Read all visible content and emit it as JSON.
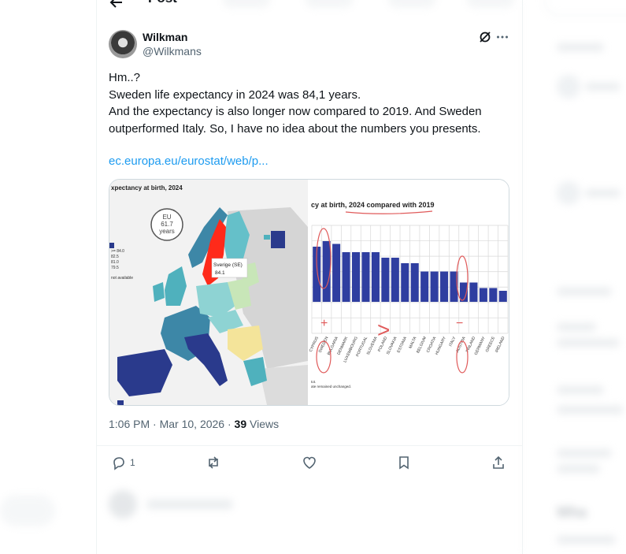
{
  "header": {
    "title": "Post"
  },
  "author": {
    "display_name": "Wilkman",
    "handle": "@Wilkmans"
  },
  "tweet": {
    "lines": [
      "Hm..?",
      "Sweden life expectancy in 2024 was 84,1 years.",
      "And the expectancy is also longer now compared to 2019. And Sweden",
      "outperformed Italy. So, I have no idea about the numbers you presents."
    ],
    "link": "ec.europa.eu/eurostat/web/p..."
  },
  "map_image": {
    "title": "xpectancy at birth, 2024",
    "eu_badge": [
      "EU",
      "61.7",
      "years"
    ],
    "legend": [
      ">= 84.0",
      "82.5",
      "81.0",
      "79.5",
      "not available"
    ],
    "callout_country": "Sverige (SE)",
    "callout_value": "84.1"
  },
  "bar_image": {
    "title": "cy at birth, 2024 compared with 2019",
    "countries": [
      "CYPRUS",
      "SWEDEN",
      "BULGARIA",
      "DENMARK",
      "LUXEMBOURG",
      "PORTUGAL",
      "SLOVENIA",
      "POLAND",
      "SLOVAKIA",
      "ESTONIA",
      "MALTA",
      "BELGIUM",
      "CROATIA",
      "HUNGARY",
      "ITALY",
      "AUSTRIA",
      "FINLAND",
      "GERMANY",
      "GREECE",
      "IRELAND"
    ],
    "values": [
      1.0,
      1.1,
      1.05,
      0.9,
      0.9,
      0.9,
      0.9,
      0.8,
      0.8,
      0.7,
      0.7,
      0.55,
      0.55,
      0.55,
      0.55,
      0.35,
      0.35,
      0.25,
      0.25,
      0.2
    ],
    "annotation_plus": "+",
    "annotation_minus": "−",
    "annotation_gt": ">",
    "footnote_1": "tot.",
    "footnote_2": "ate remained unchanged."
  },
  "meta": {
    "time": "1:06 PM",
    "date": "Mar 10, 2026",
    "views_count": "39",
    "views_label": "Views"
  },
  "actions": {
    "reply_count": "1"
  },
  "colors": {
    "accent": "#1d9bf0",
    "text": "#0f1419",
    "muted": "#536471",
    "bar": "#2f3ea0",
    "sweden": "#ff2a1a"
  }
}
